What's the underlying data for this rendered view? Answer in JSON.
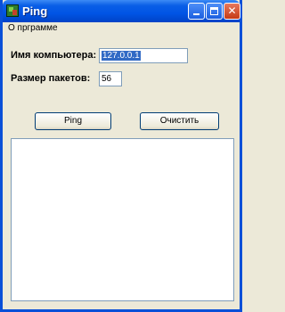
{
  "window": {
    "title": "Ping"
  },
  "menu": {
    "items": [
      "О прграмме"
    ]
  },
  "form": {
    "host_label": "Имя компьютера:",
    "host_value": "127.0.0.1",
    "size_label": "Размер пакетов:",
    "size_value": "56"
  },
  "buttons": {
    "ping": "Ping",
    "clear": "Очистить"
  },
  "output": {
    "text": ""
  }
}
